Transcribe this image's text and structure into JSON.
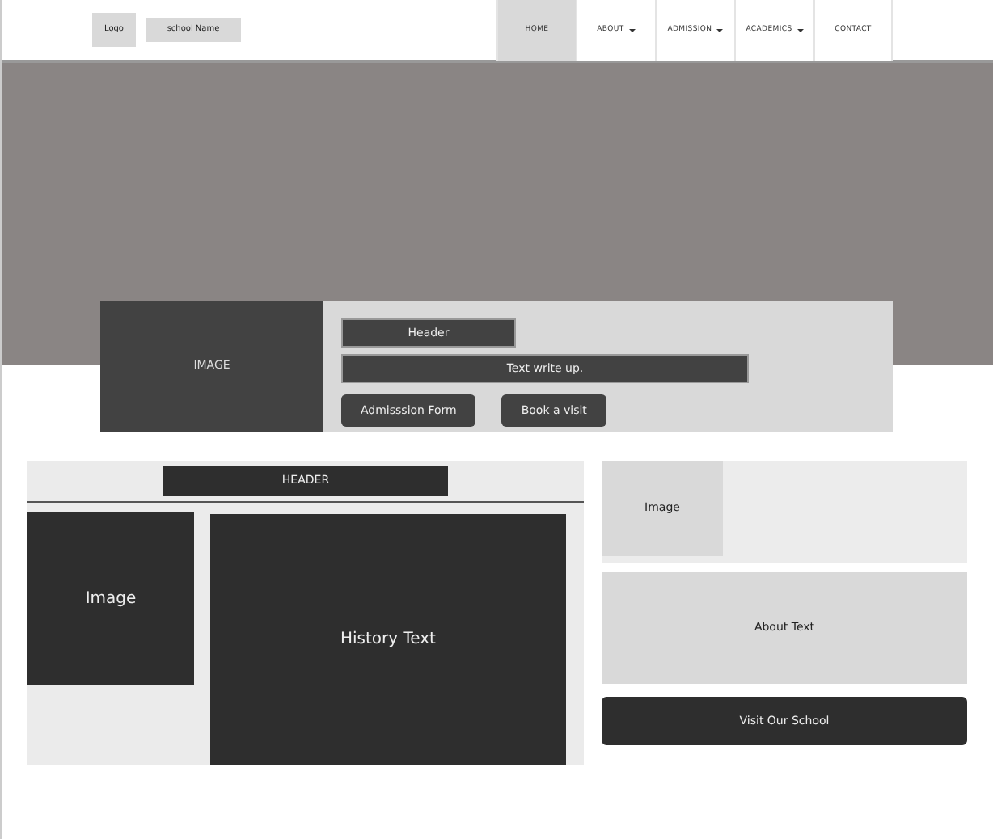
{
  "header": {
    "logo": "Logo",
    "school_name": "school Name"
  },
  "nav": [
    {
      "label": "HOME",
      "selected": true,
      "dropdown": false
    },
    {
      "label": "ABOUT",
      "selected": false,
      "dropdown": true
    },
    {
      "label": "ADMISSION",
      "selected": false,
      "dropdown": true
    },
    {
      "label": "ACADEMICS",
      "selected": false,
      "dropdown": true
    },
    {
      "label": "CONTACT",
      "selected": false,
      "dropdown": false
    }
  ],
  "hero_card": {
    "image_label": "IMAGE",
    "header": "Header",
    "text": "Text write up.",
    "buttons": [
      "Admisssion Form",
      "Book a visit"
    ]
  },
  "history": {
    "header": "HEADER",
    "image_label": "Image",
    "text": "History Text"
  },
  "side": {
    "image_label": "Image",
    "about": "About Text",
    "button": "Visit Our School"
  }
}
